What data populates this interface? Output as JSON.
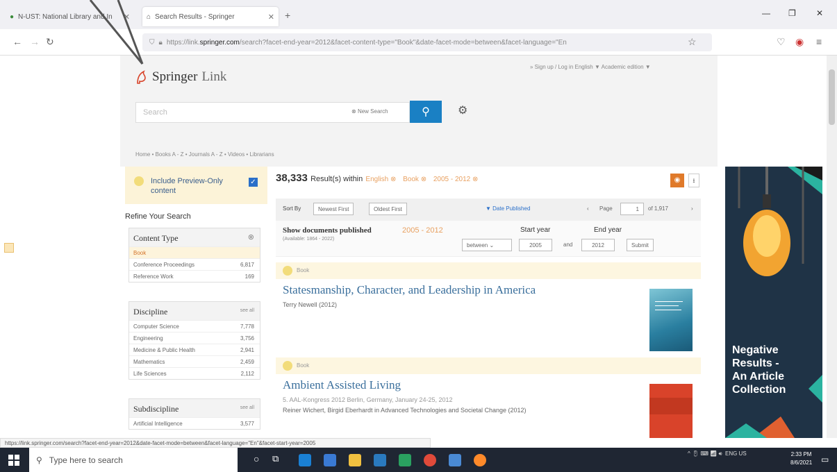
{
  "browser": {
    "tabs": [
      {
        "label": "N-UST: National Library and In",
        "active": false
      },
      {
        "label": "Search Results - Springer",
        "active": true
      }
    ],
    "url_prefix": "https://link.",
    "url_domain": "springer.com",
    "url_rest": "/search?facet-end-year=2012&facet-content-type=\"Book\"&date-facet-mode=between&facet-language=\"En",
    "status_url": "https://link.springer.com/search?facet-end-year=2012&date-facet-mode=between&facet-language=\"En\"&facet-start-year=2005"
  },
  "header": {
    "logo_springer": "Springer",
    "logo_link": "Link",
    "toplinks": "» Sign up / Log in     English ▼   Academic edition ▼",
    "search_placeholder": "Search",
    "new_search": "New Search",
    "breadcrumbs": "Home  •  Books A - Z  •  Journals A - Z  •  Videos  •  Librarians"
  },
  "sidebar": {
    "preview_label": "Include Preview-Only content",
    "refine_title": "Refine Your Search",
    "content_type": {
      "title": "Content Type",
      "items": [
        {
          "label": "Book",
          "count": "",
          "selected": true
        },
        {
          "label": "Conference Proceedings",
          "count": "6,817"
        },
        {
          "label": "Reference Work",
          "count": "169"
        }
      ]
    },
    "discipline": {
      "title": "Discipline",
      "see_all": "see all",
      "items": [
        {
          "label": "Computer Science",
          "count": "7,778"
        },
        {
          "label": "Engineering",
          "count": "3,756"
        },
        {
          "label": "Medicine & Public Health",
          "count": "2,941"
        },
        {
          "label": "Mathematics",
          "count": "2,459"
        },
        {
          "label": "Life Sciences",
          "count": "2,112"
        }
      ]
    },
    "subdiscipline": {
      "title": "Subdiscipline",
      "see_all": "see all",
      "items": [
        {
          "label": "Artificial Intelligence",
          "count": "3,577"
        }
      ]
    }
  },
  "results": {
    "count": "38,333",
    "within": "Result(s) within",
    "filters": [
      "English",
      "Book",
      "2005 - 2012"
    ],
    "sort_by": "Sort By",
    "sort_newest": "Newest First",
    "sort_oldest": "Oldest First",
    "date_published": "▼ Date Published",
    "page_label": "Page",
    "page_value": "1",
    "page_of": "of 1,917",
    "show_docs": "Show documents published",
    "show_docs_range": "2005 - 2012",
    "available": "(Available: 1864 - 2022)",
    "between": "between",
    "start_year_label": "Start year",
    "end_year_label": "End year",
    "start_year": "2005",
    "end_year": "2012",
    "and": "and",
    "submit": "Submit",
    "items": [
      {
        "type": "Book",
        "title": "Statesmanship, Character, and Leadership in America",
        "author": "Terry Newell (2012)",
        "extra": ""
      },
      {
        "type": "Book",
        "title": "Ambient Assisted Living",
        "author": "5. AAL-Kongress 2012 Berlin, Germany, January 24-25, 2012",
        "extra": "Reiner Wichert, Birgid Eberhardt in Advanced Technologies and Societal Change (2012)"
      }
    ]
  },
  "ad": {
    "text_lines": [
      "Negative",
      "Results -",
      "An Article",
      "Collection"
    ]
  },
  "taskbar": {
    "search_placeholder": "Type here to search",
    "tray": "ENG  US",
    "time": "2:33 PM",
    "date": "8/6/2021"
  },
  "colors": {
    "accent_blue": "#1a80c4",
    "link_blue": "#3a6f9c",
    "orange": "#e07a2a",
    "preview_bg": "#fcf3d8"
  }
}
